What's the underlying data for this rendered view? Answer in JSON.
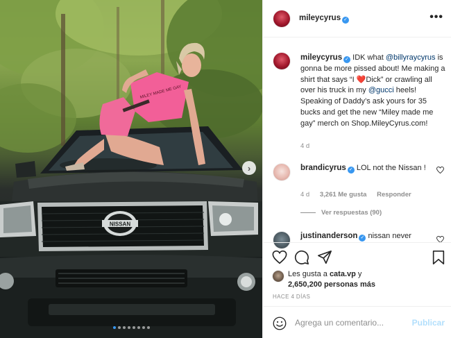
{
  "post": {
    "author": "mileycyrus",
    "caption_author": "mileycyrus",
    "caption_parts": {
      "p1": " IDK what ",
      "mention1": "@billyraycyrus",
      "p2": " is gonna be more pissed about! Me making a shirt that says “I ",
      "heart": "❤️",
      "p3": "Dick” or crawling all over his truck in my ",
      "mention2": "@gucci",
      "p4": " heels! Speaking of Daddy’s ask yours for 35 bucks and get the new “Miley made me gay” merch on Shop.MileyCyrus.com!"
    },
    "caption_age": "4 d"
  },
  "comments": [
    {
      "user": "brandicyrus",
      "text": " LOL not the Nissan !",
      "age": "4 d",
      "likes": "3,261 Me gusta",
      "reply": "Responder",
      "view_replies": "Ver respuestas (90)"
    },
    {
      "user": "justinanderson",
      "text": " nissan never"
    }
  ],
  "likes": {
    "prefix": "Les gusta a ",
    "first_user": "cata.vp",
    "suffix": " y",
    "count": "2,650,200 personas más"
  },
  "posted_ago": "HACE 4 DÍAS",
  "comment_box": {
    "placeholder": "Agrega un comentario...",
    "post_label": "Publicar"
  },
  "photo": {
    "plate_text": "NISSAN",
    "shirt_text": "MILEY MADE ME GAY",
    "carousel_count": 8,
    "carousel_active": 1,
    "next_glyph": "›"
  },
  "icons": {
    "more": "•••",
    "verified": "✓"
  },
  "colors": {
    "accent": "#3897f0",
    "mention": "#00376b",
    "muted": "#8e8e8e",
    "post_disabled": "#b2dffc"
  }
}
